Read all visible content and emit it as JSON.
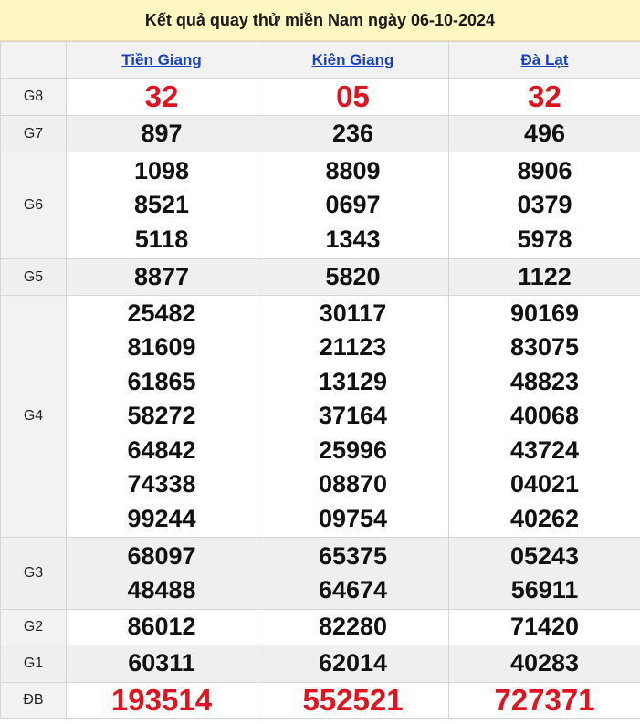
{
  "title": "Kết quả quay thử miền Nam ngày 06-10-2024",
  "provinces": [
    "Tiền Giang",
    "Kiên Giang",
    "Đà Lạt"
  ],
  "accent_red": "#e0141e",
  "link_color": "#1a3fc7",
  "rows": [
    {
      "label": "G8",
      "values": [
        [
          "32"
        ],
        [
          "05"
        ],
        [
          "32"
        ]
      ]
    },
    {
      "label": "G7",
      "values": [
        [
          "897"
        ],
        [
          "236"
        ],
        [
          "496"
        ]
      ]
    },
    {
      "label": "G6",
      "values": [
        [
          "1098",
          "8521",
          "5118"
        ],
        [
          "8809",
          "0697",
          "1343"
        ],
        [
          "8906",
          "0379",
          "5978"
        ]
      ]
    },
    {
      "label": "G5",
      "values": [
        [
          "8877"
        ],
        [
          "5820"
        ],
        [
          "1122"
        ]
      ]
    },
    {
      "label": "G4",
      "values": [
        [
          "25482",
          "81609",
          "61865",
          "58272",
          "64842",
          "74338",
          "99244"
        ],
        [
          "30117",
          "21123",
          "13129",
          "37164",
          "25996",
          "08870",
          "09754"
        ],
        [
          "90169",
          "83075",
          "48823",
          "40068",
          "43724",
          "04021",
          "40262"
        ]
      ]
    },
    {
      "label": "G3",
      "values": [
        [
          "68097",
          "48488"
        ],
        [
          "65375",
          "64674"
        ],
        [
          "05243",
          "56911"
        ]
      ]
    },
    {
      "label": "G2",
      "values": [
        [
          "86012"
        ],
        [
          "82280"
        ],
        [
          "71420"
        ]
      ]
    },
    {
      "label": "G1",
      "values": [
        [
          "60311"
        ],
        [
          "62014"
        ],
        [
          "40283"
        ]
      ]
    },
    {
      "label": "ĐB",
      "values": [
        [
          "193514"
        ],
        [
          "552521"
        ],
        [
          "727371"
        ]
      ]
    }
  ]
}
